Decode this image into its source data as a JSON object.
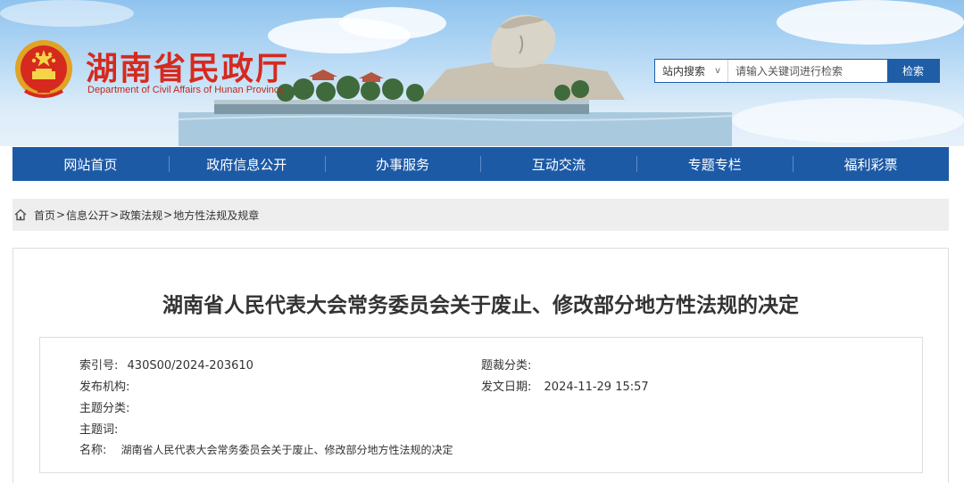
{
  "header": {
    "site_title": "湖南省民政厅",
    "site_subtitle": "Department of Civil Affairs of Hunan Province",
    "search": {
      "scope": "站内搜索",
      "placeholder": "请输入关键词进行检索",
      "button": "检索"
    }
  },
  "nav": {
    "items": [
      {
        "label": "网站首页"
      },
      {
        "label": "政府信息公开"
      },
      {
        "label": "办事服务"
      },
      {
        "label": "互动交流"
      },
      {
        "label": "专题专栏"
      },
      {
        "label": "福利彩票"
      }
    ]
  },
  "breadcrumb": {
    "items": [
      "首页",
      "信息公开",
      "政策法规",
      "地方性法规及规章"
    ],
    "separator": ">"
  },
  "article": {
    "title": "湖南省人民代表大会常务委员会关于废止、修改部分地方性法规的决定",
    "meta": {
      "index_label": "索引号:",
      "index_value": "430S00/2024-203610",
      "genre_label": "题裁分类:",
      "genre_value": "",
      "publisher_label": "发布机构:",
      "publisher_value": "",
      "date_label": "发文日期:",
      "date_value": "2024-11-29 15:57",
      "topic_label": "主题分类:",
      "topic_value": "",
      "keywords_label": "主题词:",
      "keywords_value": "",
      "name_label": "名称:",
      "name_value": "湖南省人民代表大会常务委员会关于废止、修改部分地方性法规的决定"
    }
  },
  "colors": {
    "nav_bg": "#1d5aa6",
    "title_red": "#d62a1e",
    "breadcrumb_bg": "#eeeeee"
  }
}
